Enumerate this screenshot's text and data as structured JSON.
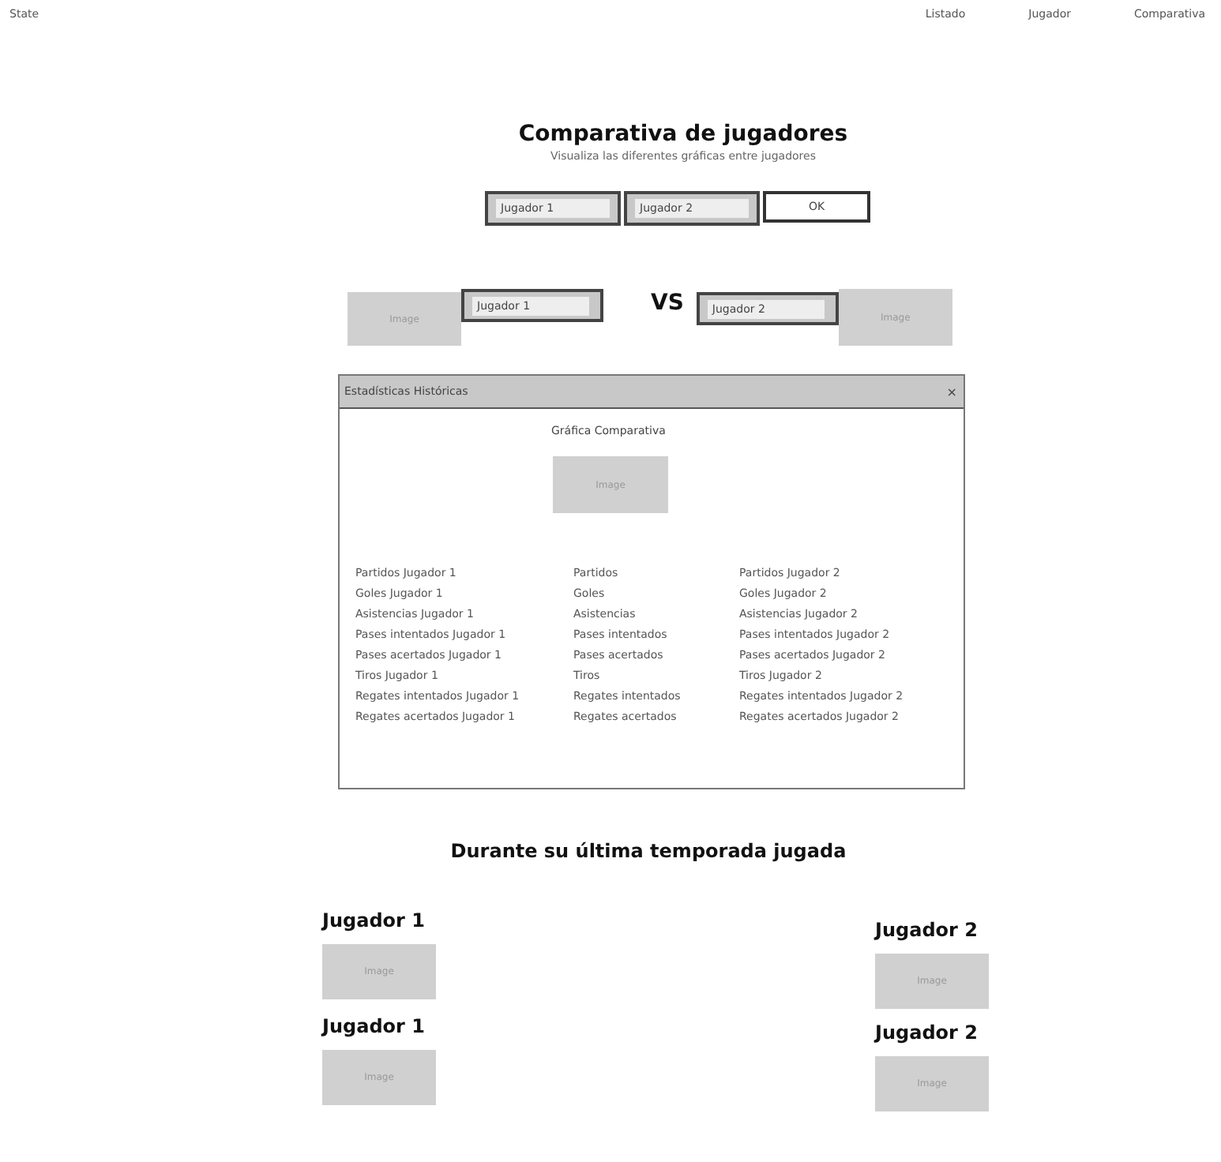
{
  "nav": {
    "brand": "State",
    "links": [
      "Listado",
      "Jugador",
      "Comparativa"
    ]
  },
  "header": {
    "title": "Comparativa de jugadores",
    "subtitle": "Visualiza las diferentes gráficas entre jugadores"
  },
  "selector": {
    "fields": [
      {
        "value": "Jugador 1"
      },
      {
        "value": "Jugador 2"
      }
    ],
    "button": "OK"
  },
  "versus": {
    "left": {
      "image": "Image",
      "field": "Jugador 1"
    },
    "label": "VS",
    "right": {
      "field": "Jugador 2",
      "image": "Image"
    }
  },
  "window": {
    "title": "Estadísticas Históricas",
    "close": "×",
    "chart_title": "Gráfica Comparativa",
    "image": "Image",
    "columns": [
      [
        "Partidos Jugador 1",
        "Goles Jugador 1",
        "Asistencias Jugador 1",
        "Pases intentados Jugador 1",
        "Pases acertados Jugador 1",
        "Tiros Jugador 1",
        "Regates intentados Jugador 1",
        "Regates acertados Jugador 1"
      ],
      [
        "Partidos",
        "Goles",
        "Asistencias",
        "Pases intentados",
        "Pases acertados",
        "Tiros",
        "Regates intentados",
        "Regates acertados"
      ],
      [
        "Partidos Jugador 2",
        "Goles Jugador 2",
        "Asistencias Jugador 2",
        "Pases intentados Jugador 2",
        "Pases acertados Jugador 2",
        "Tiros Jugador 2",
        "Regates intentados Jugador 2",
        "Regates acertados Jugador 2"
      ]
    ]
  },
  "season": {
    "title": "Durante su última temporada jugada",
    "left": [
      {
        "name": "Jugador 1",
        "image": "Image"
      },
      {
        "name": "Jugador 1",
        "image": "Image"
      }
    ],
    "right": [
      {
        "name": "Jugador 2",
        "image": "Image"
      },
      {
        "name": "Jugador 2",
        "image": "Image"
      }
    ]
  }
}
